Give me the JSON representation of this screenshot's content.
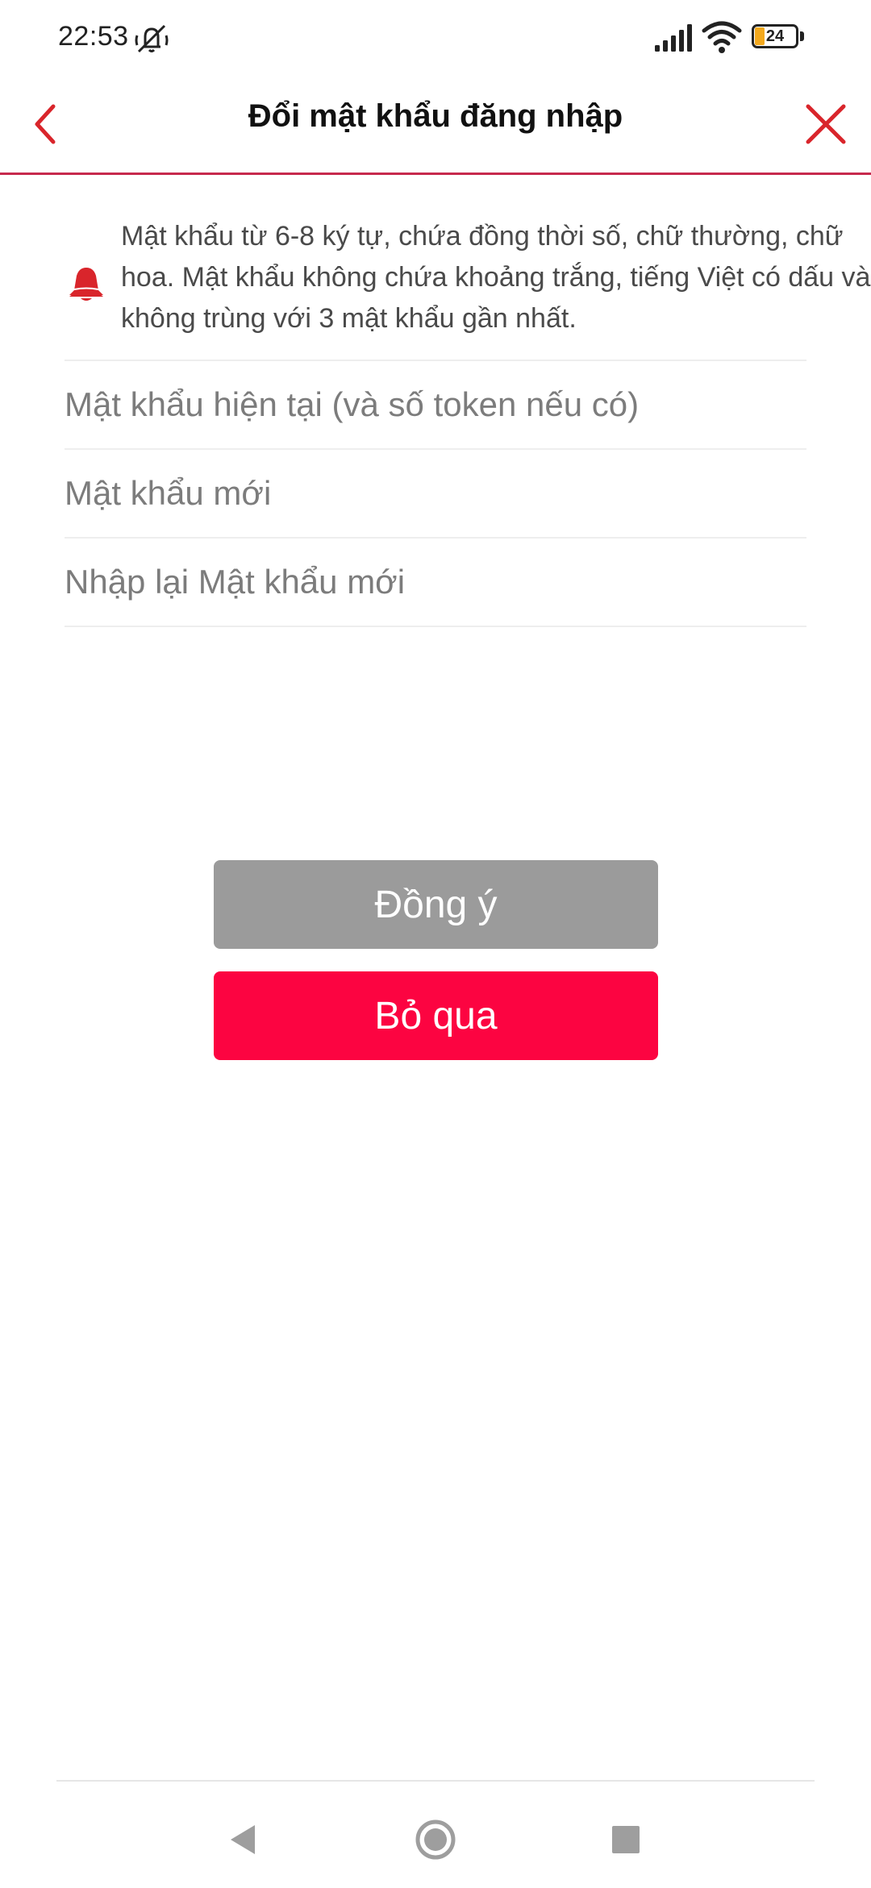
{
  "status_bar": {
    "time": "22:53",
    "battery_level": "24",
    "battery_fraction": 0.24,
    "icons": [
      "mute-icon",
      "signal-icon",
      "wifi-icon",
      "battery-icon"
    ]
  },
  "header": {
    "title": "Đổi mật khẩu đăng nhập",
    "back_icon": "chevron-left-icon",
    "close_icon": "close-icon"
  },
  "notice": {
    "icon": "bell-icon",
    "text": "Mật khẩu từ 6-8 ký tự, chứa đồng thời số, chữ thường, chữ hoa. Mật khẩu không chứa khoảng trắng, tiếng Việt có dấu và không trùng với 3 mật khẩu gần nhất."
  },
  "form": {
    "current_password": {
      "placeholder": "Mật khẩu hiện tại (và số token nếu có)",
      "value": ""
    },
    "new_password": {
      "placeholder": "Mật khẩu mới",
      "value": ""
    },
    "confirm_password": {
      "placeholder": "Nhập lại Mật khẩu mới",
      "value": ""
    }
  },
  "actions": {
    "confirm_label": "Đồng ý",
    "skip_label": "Bỏ qua"
  },
  "colors": {
    "accent": "#c7294d",
    "skip_button": "#fc0441",
    "confirm_button_disabled": "#9b9b9b",
    "bell": "#d9252b"
  },
  "nav_bar": {
    "icons": [
      "nav-back-icon",
      "nav-home-icon",
      "nav-recent-icon"
    ]
  }
}
